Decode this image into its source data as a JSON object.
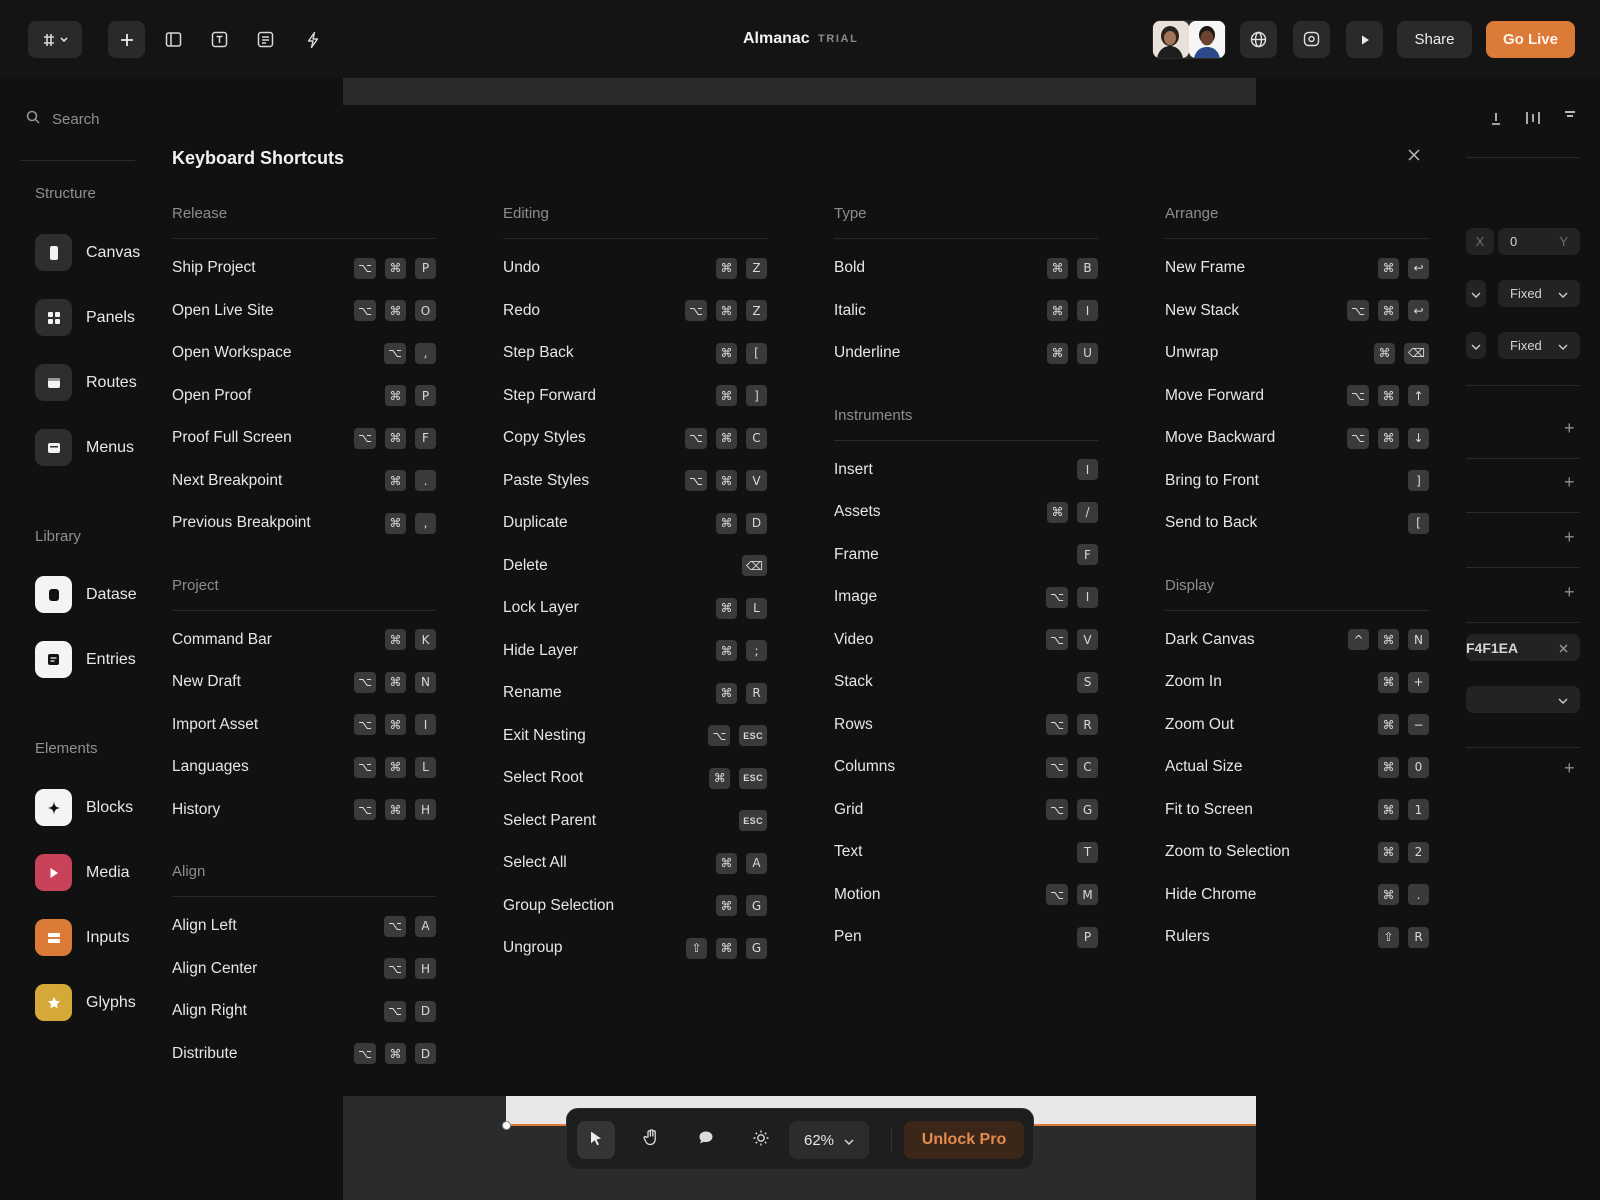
{
  "app": {
    "title": "Almanac",
    "badge": "TRIAL"
  },
  "topbar": {
    "share_label": "Share",
    "go_live_label": "Go Live",
    "tools": [
      "grid-menu-icon",
      "plus-icon",
      "sidebar-icon",
      "text-box-icon",
      "list-box-icon",
      "lightning-icon"
    ],
    "right_icons": [
      "globe-icon",
      "preview-icon",
      "play-icon"
    ]
  },
  "sidebar": {
    "search_placeholder": "Search",
    "sections": [
      {
        "title": "Structure",
        "items": [
          {
            "label": "Canvas",
            "icon": "canvas-icon",
            "color": "#2e2e2e"
          },
          {
            "label": "Panels",
            "icon": "grid-icon",
            "color": "#2e2e2e"
          },
          {
            "label": "Routes",
            "icon": "page-icon",
            "color": "#2e2e2e"
          },
          {
            "label": "Menus",
            "icon": "menu-icon",
            "color": "#2e2e2e"
          }
        ]
      },
      {
        "title": "Library",
        "items": [
          {
            "label": "Datase",
            "icon": "database-icon",
            "color": "#f4f4f4"
          },
          {
            "label": "Entries",
            "icon": "entries-icon",
            "color": "#f4f4f4"
          }
        ]
      },
      {
        "title": "Elements",
        "items": [
          {
            "label": "Blocks",
            "icon": "sparkle-icon",
            "color": "#f4f4f4"
          },
          {
            "label": "Media",
            "icon": "play-icon",
            "color": "#c8425a"
          },
          {
            "label": "Inputs",
            "icon": "input-icon",
            "color": "#dc7a37"
          },
          {
            "label": "Glyphs",
            "icon": "star-icon",
            "color": "#d4a93a"
          }
        ]
      }
    ]
  },
  "inspector": {
    "x_label": "X",
    "y_value": "0",
    "y_label": "Y",
    "width_mode": "Fixed",
    "height_mode": "Fixed",
    "color_value": "F4F1EA"
  },
  "modal": {
    "title": "Keyboard Shortcuts",
    "columns": [
      {
        "groups": [
          {
            "title": "Release",
            "rows": [
              {
                "label": "Ship Project",
                "keys": [
                  "⌥",
                  "⌘",
                  "P"
                ]
              },
              {
                "label": "Open Live Site",
                "keys": [
                  "⌥",
                  "⌘",
                  "O"
                ]
              },
              {
                "label": "Open Workspace",
                "keys": [
                  "⌥",
                  ","
                ]
              },
              {
                "label": "Open Proof",
                "keys": [
                  "⌘",
                  "P"
                ]
              },
              {
                "label": "Proof Full Screen",
                "keys": [
                  "⌥",
                  "⌘",
                  "F"
                ]
              },
              {
                "label": "Next Breakpoint",
                "keys": [
                  "⌘",
                  "."
                ]
              },
              {
                "label": "Previous Breakpoint",
                "keys": [
                  "⌘",
                  ","
                ]
              }
            ]
          },
          {
            "title": "Project",
            "rows": [
              {
                "label": "Command Bar",
                "keys": [
                  "⌘",
                  "K"
                ]
              },
              {
                "label": "New Draft",
                "keys": [
                  "⌥",
                  "⌘",
                  "N"
                ]
              },
              {
                "label": "Import Asset",
                "keys": [
                  "⌥",
                  "⌘",
                  "I"
                ]
              },
              {
                "label": "Languages",
                "keys": [
                  "⌥",
                  "⌘",
                  "L"
                ]
              },
              {
                "label": "History",
                "keys": [
                  "⌥",
                  "⌘",
                  "H"
                ]
              }
            ]
          },
          {
            "title": "Align",
            "rows": [
              {
                "label": "Align Left",
                "keys": [
                  "⌥",
                  "A"
                ]
              },
              {
                "label": "Align Center",
                "keys": [
                  "⌥",
                  "H"
                ]
              },
              {
                "label": "Align Right",
                "keys": [
                  "⌥",
                  "D"
                ]
              },
              {
                "label": "Distribute",
                "keys": [
                  "⌥",
                  "⌘",
                  "D"
                ]
              }
            ]
          }
        ]
      },
      {
        "groups": [
          {
            "title": "Editing",
            "rows": [
              {
                "label": "Undo",
                "keys": [
                  "⌘",
                  "Z"
                ]
              },
              {
                "label": "Redo",
                "keys": [
                  "⌥",
                  "⌘",
                  "Z"
                ]
              },
              {
                "label": "Step Back",
                "keys": [
                  "⌘",
                  "["
                ]
              },
              {
                "label": "Step Forward",
                "keys": [
                  "⌘",
                  "]"
                ]
              },
              {
                "label": "Copy Styles",
                "keys": [
                  "⌥",
                  "⌘",
                  "C"
                ]
              },
              {
                "label": "Paste Styles",
                "keys": [
                  "⌥",
                  "⌘",
                  "V"
                ]
              },
              {
                "label": "Duplicate",
                "keys": [
                  "⌘",
                  "D"
                ]
              },
              {
                "label": "Delete",
                "keys": [
                  "⌫"
                ]
              },
              {
                "label": "Lock Layer",
                "keys": [
                  "⌘",
                  "L"
                ]
              },
              {
                "label": "Hide Layer",
                "keys": [
                  "⌘",
                  ";"
                ]
              },
              {
                "label": "Rename",
                "keys": [
                  "⌘",
                  "R"
                ]
              },
              {
                "label": "Exit Nesting",
                "keys": [
                  "⌥",
                  "ESC"
                ]
              },
              {
                "label": "Select Root",
                "keys": [
                  "⌘",
                  "ESC"
                ]
              },
              {
                "label": "Select Parent",
                "keys": [
                  "ESC"
                ]
              },
              {
                "label": "Select All",
                "keys": [
                  "⌘",
                  "A"
                ]
              },
              {
                "label": "Group Selection",
                "keys": [
                  "⌘",
                  "G"
                ]
              },
              {
                "label": "Ungroup",
                "keys": [
                  "⇧",
                  "⌘",
                  "G"
                ]
              }
            ]
          }
        ]
      },
      {
        "groups": [
          {
            "title": "Type",
            "rows": [
              {
                "label": "Bold",
                "keys": [
                  "⌘",
                  "B"
                ]
              },
              {
                "label": "Italic",
                "keys": [
                  "⌘",
                  "I"
                ]
              },
              {
                "label": "Underline",
                "keys": [
                  "⌘",
                  "U"
                ]
              }
            ]
          },
          {
            "title": "Instruments",
            "rows": [
              {
                "label": "Insert",
                "keys": [
                  "I"
                ]
              },
              {
                "label": "Assets",
                "keys": [
                  "⌘",
                  "/"
                ]
              },
              {
                "label": "Frame",
                "keys": [
                  "F"
                ]
              },
              {
                "label": "Image",
                "keys": [
                  "⌥",
                  "I"
                ]
              },
              {
                "label": "Video",
                "keys": [
                  "⌥",
                  "V"
                ]
              },
              {
                "label": "Stack",
                "keys": [
                  "S"
                ]
              },
              {
                "label": "Rows",
                "keys": [
                  "⌥",
                  "R"
                ]
              },
              {
                "label": "Columns",
                "keys": [
                  "⌥",
                  "C"
                ]
              },
              {
                "label": "Grid",
                "keys": [
                  "⌥",
                  "G"
                ]
              },
              {
                "label": "Text",
                "keys": [
                  "T"
                ]
              },
              {
                "label": "Motion",
                "keys": [
                  "⌥",
                  "M"
                ]
              },
              {
                "label": "Pen",
                "keys": [
                  "P"
                ]
              }
            ]
          }
        ]
      },
      {
        "groups": [
          {
            "title": "Arrange",
            "rows": [
              {
                "label": "New Frame",
                "keys": [
                  "⌘",
                  "↩"
                ]
              },
              {
                "label": "New Stack",
                "keys": [
                  "⌥",
                  "⌘",
                  "↩"
                ]
              },
              {
                "label": "Unwrap",
                "keys": [
                  "⌘",
                  "⌫"
                ]
              },
              {
                "label": "Move Forward",
                "keys": [
                  "⌥",
                  "⌘",
                  "↑"
                ]
              },
              {
                "label": "Move Backward",
                "keys": [
                  "⌥",
                  "⌘",
                  "↓"
                ]
              },
              {
                "label": "Bring to Front",
                "keys": [
                  "]"
                ]
              },
              {
                "label": "Send to Back",
                "keys": [
                  "["
                ]
              }
            ]
          },
          {
            "title": "Display",
            "rows": [
              {
                "label": "Dark Canvas",
                "keys": [
                  "^",
                  "⌘",
                  "N"
                ]
              },
              {
                "label": "Zoom In",
                "keys": [
                  "⌘",
                  "+"
                ]
              },
              {
                "label": "Zoom Out",
                "keys": [
                  "⌘",
                  "−"
                ]
              },
              {
                "label": "Actual Size",
                "keys": [
                  "⌘",
                  "0"
                ]
              },
              {
                "label": "Fit to Screen",
                "keys": [
                  "⌘",
                  "1"
                ]
              },
              {
                "label": "Zoom to Selection",
                "keys": [
                  "⌘",
                  "2"
                ]
              },
              {
                "label": "Hide Chrome",
                "keys": [
                  "⌘",
                  "."
                ]
              },
              {
                "label": "Rulers",
                "keys": [
                  "⇧",
                  "R"
                ]
              }
            ]
          }
        ]
      }
    ]
  },
  "toolbar": {
    "zoom": "62%",
    "unlock_label": "Unlock Pro",
    "tools": [
      "pointer-icon",
      "hand-icon",
      "comment-icon",
      "theme-icon"
    ]
  }
}
